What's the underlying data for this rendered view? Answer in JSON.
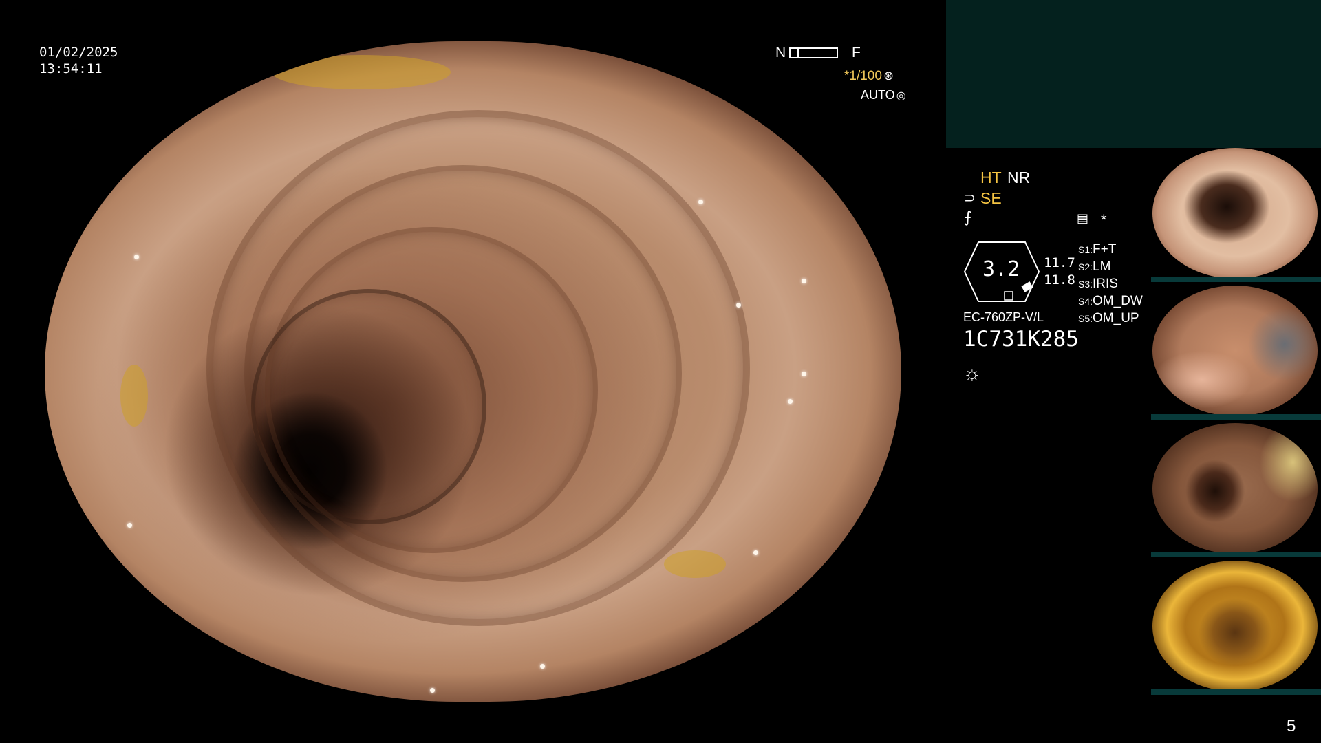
{
  "overlay": {
    "date": "01/02/2025",
    "time": "13:54:11",
    "near_label": "N",
    "far_label": "F",
    "shutter": "*1/100",
    "shutter_icon": "shutter-icon",
    "iris_mode": "AUTO",
    "iris_icon": "iris-icon"
  },
  "panel": {
    "ht": "HT",
    "nr": "NR",
    "se": "SE",
    "se_icon": "enhancement-icon",
    "func_icon": "function-icon",
    "record_icon": "record-icon",
    "asterisk": "*",
    "zoom_value": "3.2",
    "value_a": "11.7",
    "value_b": "11.8",
    "scope_model": "EC-760ZP-V/L",
    "serial": "1C731K285",
    "light_icon": "light-icon",
    "switches": [
      {
        "key": "S1",
        "value": "F+T"
      },
      {
        "key": "S2",
        "value": "LM"
      },
      {
        "key": "S3",
        "value": "IRIS"
      },
      {
        "key": "S4",
        "value": "OM_DW"
      },
      {
        "key": "S5",
        "value": "OM_UP"
      }
    ]
  },
  "colors": {
    "accent_yellow": "#f5c443",
    "teal_panel": "#04211e",
    "background": "#000000"
  },
  "page_number": "5"
}
